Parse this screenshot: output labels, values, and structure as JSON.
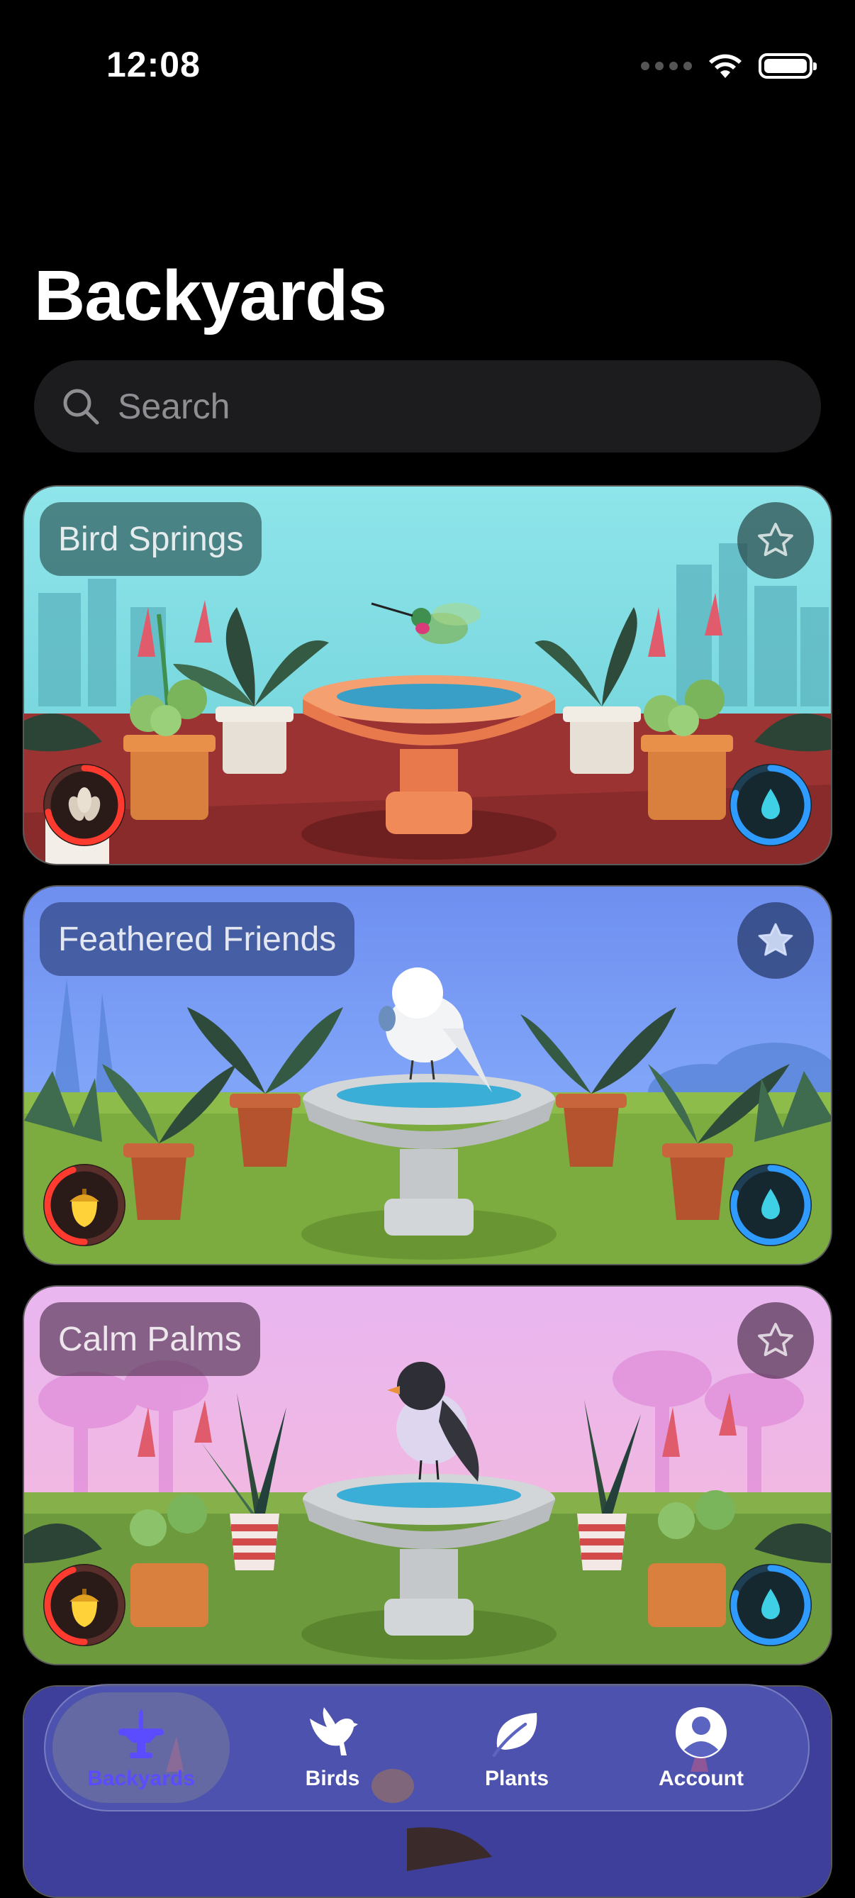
{
  "status": {
    "time": "12:08"
  },
  "page": {
    "title": "Backyards"
  },
  "search": {
    "placeholder": "Search"
  },
  "cards": [
    {
      "title": "Bird Springs",
      "favorite": false,
      "food": "seeds",
      "food_level": 0.72,
      "water_level": 0.8
    },
    {
      "title": "Feathered Friends",
      "favorite": true,
      "food": "acorn",
      "food_level": 0.45,
      "water_level": 0.8
    },
    {
      "title": "Calm Palms",
      "favorite": false,
      "food": "acorn",
      "food_level": 0.45,
      "water_level": 0.8
    }
  ],
  "tabs": [
    {
      "label": "Backyards",
      "icon": "birdbath-icon",
      "active": true
    },
    {
      "label": "Birds",
      "icon": "bird-icon",
      "active": false
    },
    {
      "label": "Plants",
      "icon": "leaf-icon",
      "active": false
    },
    {
      "label": "Account",
      "icon": "person-circle-icon",
      "active": false
    }
  ],
  "colors": {
    "accent": "#5b4dff",
    "food_ring": "#ff3b30",
    "water_ring": "#2f9bff"
  }
}
